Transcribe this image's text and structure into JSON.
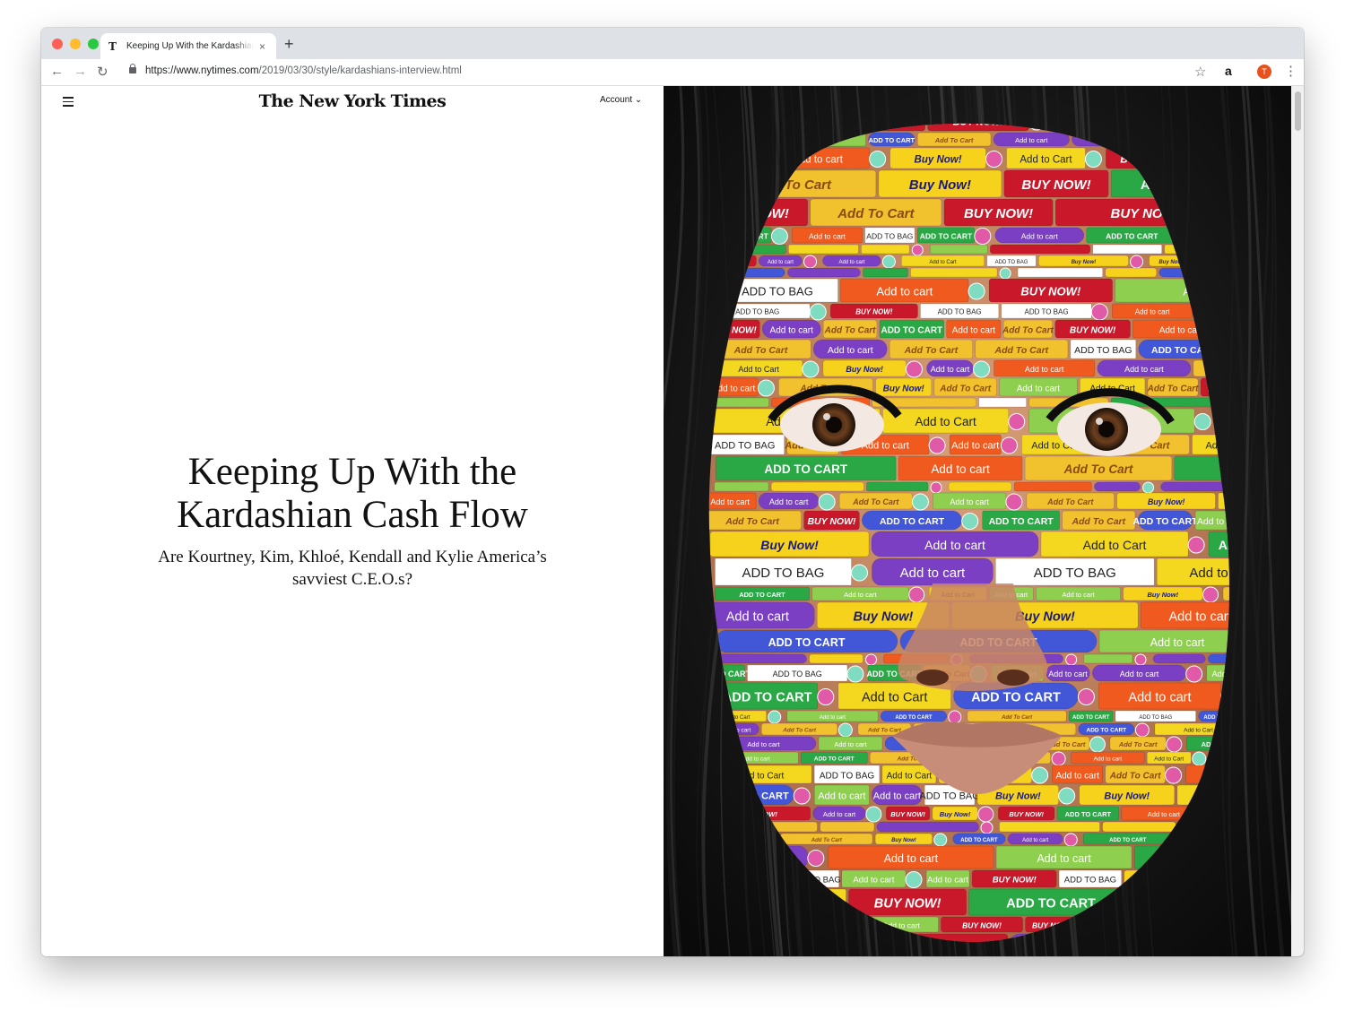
{
  "browser": {
    "tab_title": "Keeping Up With the Kardashians",
    "tab_favicon": "T",
    "new_tab": "+",
    "tab_close": "×",
    "url_domain": "https://www.nytimes.com",
    "url_path": "/2019/03/30/style/kardashians-interview.html",
    "profile_initial": "T",
    "ext_icon": "a",
    "icons": [
      "back-icon",
      "forward-icon",
      "reload-icon",
      "lock-icon",
      "star-icon",
      "amazon-icon",
      "profile-icon",
      "menu-icon"
    ],
    "traffic_lights": [
      "#fe5f57",
      "#febc2e",
      "#28c840"
    ]
  },
  "site": {
    "masthead": "The New York Times",
    "account_label": "Account"
  },
  "article": {
    "headline_line1": "Keeping Up With the",
    "headline_line2": "Kardashian Cash Flow",
    "dek_line1": "Are Kourtney, Kim, Khloé, Kendall and Kylie America’s",
    "dek_line2": "savviest C.E.O.s?"
  },
  "illustration": {
    "buttons": [
      {
        "label": "Buy Now!",
        "style": "yellow"
      },
      {
        "label": "Add To Cart",
        "style": "yellow-italic"
      },
      {
        "label": "Add to cart",
        "style": "purple"
      },
      {
        "label": "BUY NOW!",
        "style": "red"
      },
      {
        "label": "ADD TO CART",
        "style": "green"
      },
      {
        "label": "ADD TO CART",
        "style": "blue-pill"
      },
      {
        "label": "Add to cart",
        "style": "orange"
      },
      {
        "label": "Add to Cart",
        "style": "yellow-icon"
      },
      {
        "label": "ADD TO BAG",
        "style": "white"
      },
      {
        "label": "Add to cart",
        "style": "lightgreen"
      }
    ]
  }
}
